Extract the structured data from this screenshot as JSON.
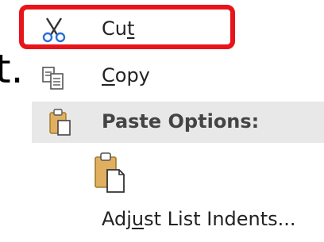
{
  "background_text": "t.",
  "menu": {
    "cut": {
      "label_pre": "Cu",
      "label_u": "t",
      "label_post": "",
      "icon": "scissors-icon"
    },
    "copy": {
      "label_pre": "",
      "label_u": "C",
      "label_post": "opy",
      "icon": "copy-icon"
    },
    "paste_options": {
      "label": "Paste Options:",
      "icon": "clipboard-icon"
    },
    "paste_keep": {
      "icon": "paste-clipboard-icon"
    },
    "adjust": {
      "label_pre": "Adj",
      "label_u": "u",
      "label_post": "st List Indents...",
      "icon": ""
    }
  },
  "colors": {
    "highlight": "#e8141b",
    "header_bg": "#e8e8e8",
    "clipboard": "#e0b060"
  }
}
